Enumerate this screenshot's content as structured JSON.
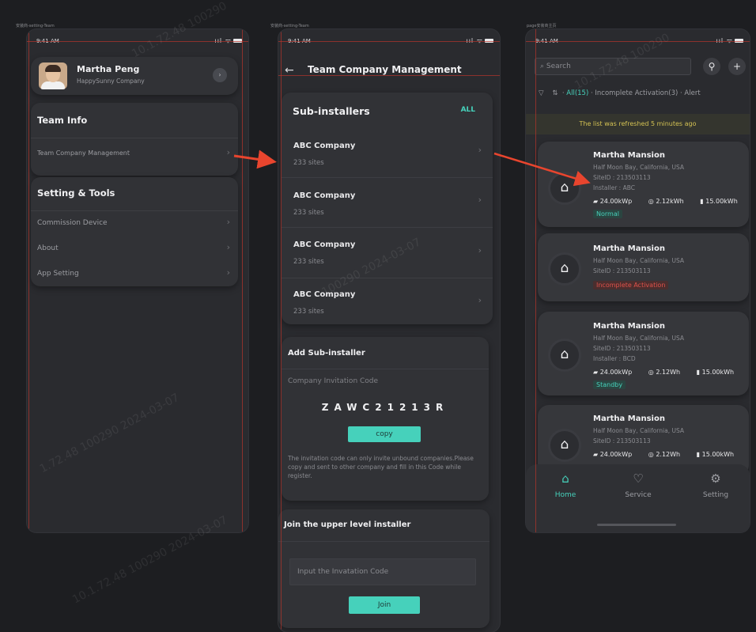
{
  "frames": [
    "安装商-setting-Team",
    "安装商-setting-Team",
    "page安装商主页"
  ],
  "status_bar": {
    "time": "9:41 AM"
  },
  "profile": {
    "name": "Martha Peng",
    "company": "HappySunny Company"
  },
  "team_info": {
    "title": "Team Info",
    "items": [
      "Team Company Management"
    ]
  },
  "setting_tools": {
    "title": "Setting & Tools",
    "items": [
      "Commission Device",
      "About",
      "App Setting"
    ]
  },
  "team_company": {
    "title": "Team Company Management",
    "sub_installers": {
      "title": "Sub-installers",
      "all_label": "ALL",
      "rows": [
        {
          "name": "ABC Company",
          "sites": "233 sites"
        },
        {
          "name": "ABC Company",
          "sites": "233 sites"
        },
        {
          "name": "ABC Company",
          "sites": "233 sites"
        },
        {
          "name": "ABC Company",
          "sites": "233 sites"
        }
      ]
    },
    "add_sub": {
      "title": "Add Sub-installer",
      "label": "Company Invitation Code",
      "code": "ZAWC21213R",
      "copy": "copy",
      "note": "The invitation code can only invite unbound companies.Please copy and sent to other company and fill in this Code while register."
    },
    "join": {
      "title": "Join the upper level installer",
      "placeholder": "Input the Invatation Code",
      "button": "Join"
    }
  },
  "home": {
    "search_placeholder": "Search",
    "filters": {
      "all": "All(15)",
      "incomplete": "Incomplete Activation(3)",
      "alert": "Alert"
    },
    "refresh_notice": "The list was refreshed 5 minutes ago",
    "sites": [
      {
        "name": "Martha Mansion",
        "location": "Half Moon Bay, California, USA",
        "siteid": "SiteID : 213503113",
        "installer": "Installer : ABC",
        "wp": "24.00kWp",
        "kwh": "2.12kWh",
        "kwh2": "15.00kWh",
        "status": "Normal",
        "status_color": "#46d1bb"
      },
      {
        "name": "Martha Mansion",
        "location": "Half Moon Bay, California, USA",
        "siteid": "SiteID : 213503113",
        "status": "Incomplete Activation",
        "status_color": "#e0514a"
      },
      {
        "name": "Martha Mansion",
        "location": "Half Moon Bay, California, USA",
        "siteid": "SiteID : 213503113",
        "installer": "Installer : BCD",
        "wp": "24.00kWp",
        "kwh": "2.12Wh",
        "kwh2": "15.00kWh",
        "status": "Standby",
        "status_color": "#46d1bb"
      },
      {
        "name": "Martha Mansion",
        "location": "Half Moon Bay, California, USA",
        "siteid": "SiteID : 213503113",
        "wp": "24.00kWp",
        "kwh": "2.12Wh",
        "kwh2": "15.00kWh"
      }
    ],
    "tabs": {
      "home": "Home",
      "service": "Service",
      "setting": "Setting"
    }
  },
  "colors": {
    "accent": "#46d1bb",
    "alert": "#e0514a",
    "arrow": "#e8452e"
  }
}
